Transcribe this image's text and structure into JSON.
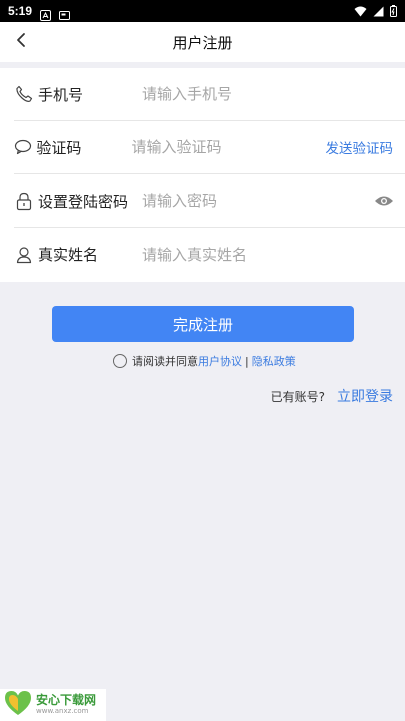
{
  "status_bar": {
    "time": "5:19"
  },
  "header": {
    "title": "用户注册"
  },
  "form": {
    "phone": {
      "label": "手机号",
      "placeholder": "请输入手机号"
    },
    "code": {
      "label": "验证码",
      "placeholder": "请输入验证码",
      "send_label": "发送验证码"
    },
    "password": {
      "label": "设置登陆密码",
      "placeholder": "请输入密码"
    },
    "name": {
      "label": "真实姓名",
      "placeholder": "请输入真实姓名"
    }
  },
  "actions": {
    "submit_label": "完成注册",
    "agree_text": "请阅读并同意",
    "user_agreement": "用户协议",
    "separator": "|",
    "privacy_policy": "隐私政策",
    "have_account": "已有账号?",
    "login_now": "立即登录"
  },
  "watermark": {
    "name": "安心下载网",
    "url": "www.anxz.com"
  },
  "colors": {
    "accent": "#4285f4",
    "link": "#3a7be0",
    "background": "#efeff4"
  },
  "icons": [
    "phone-icon",
    "chat-bubble-icon",
    "lock-icon",
    "person-icon",
    "eye-icon",
    "back-arrow-icon"
  ]
}
